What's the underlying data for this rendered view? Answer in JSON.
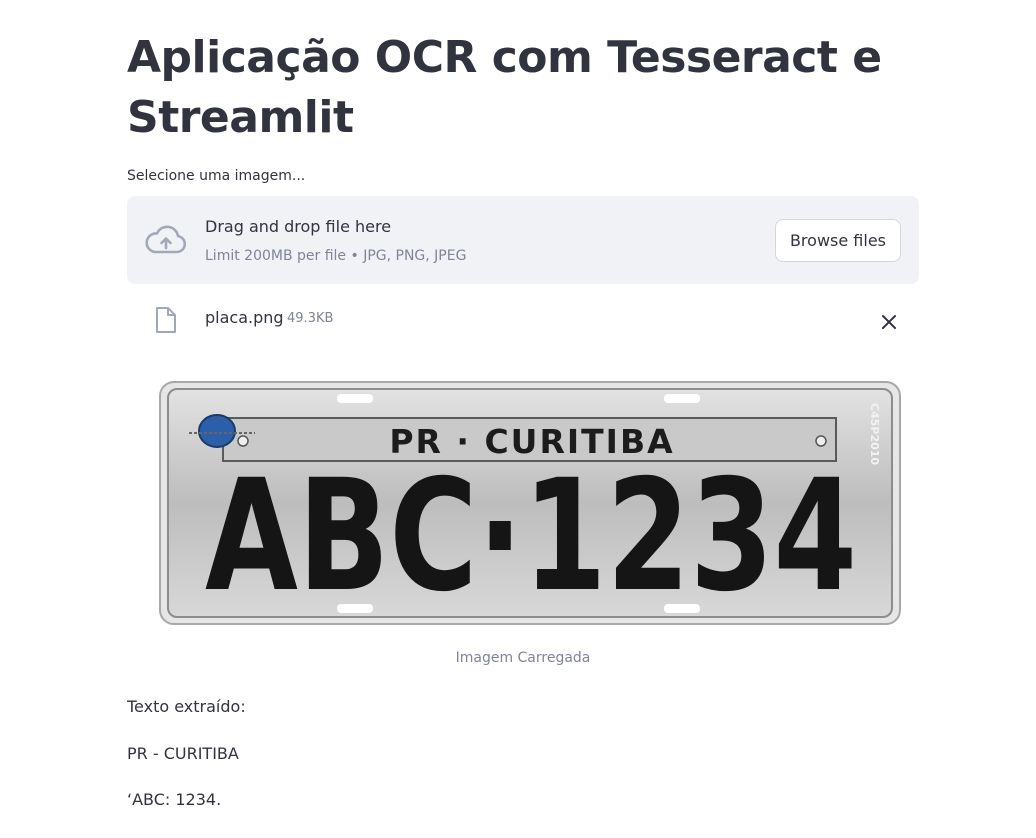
{
  "page": {
    "title": "Aplicação OCR com Tesseract e Streamlit"
  },
  "uploader": {
    "label": "Selecione uma imagem...",
    "drop_text": "Drag and drop file here",
    "limit_text": "Limit 200MB per file • JPG, PNG, JPEG",
    "browse_label": "Browse files",
    "upload_icon": "cloud-upload-icon"
  },
  "file": {
    "name": "placa.png",
    "size": "49.3KB",
    "file_icon": "file-icon",
    "remove_icon": "close-icon"
  },
  "image": {
    "caption": "Imagem Carregada",
    "plate_region": "PR · CURITIBA",
    "plate_number": "ABC·1234",
    "side_code": "C45P2010"
  },
  "output": {
    "label": "Texto extraído:",
    "line1": "PR - CURITIBA",
    "line2": "‘ABC: 1234."
  }
}
